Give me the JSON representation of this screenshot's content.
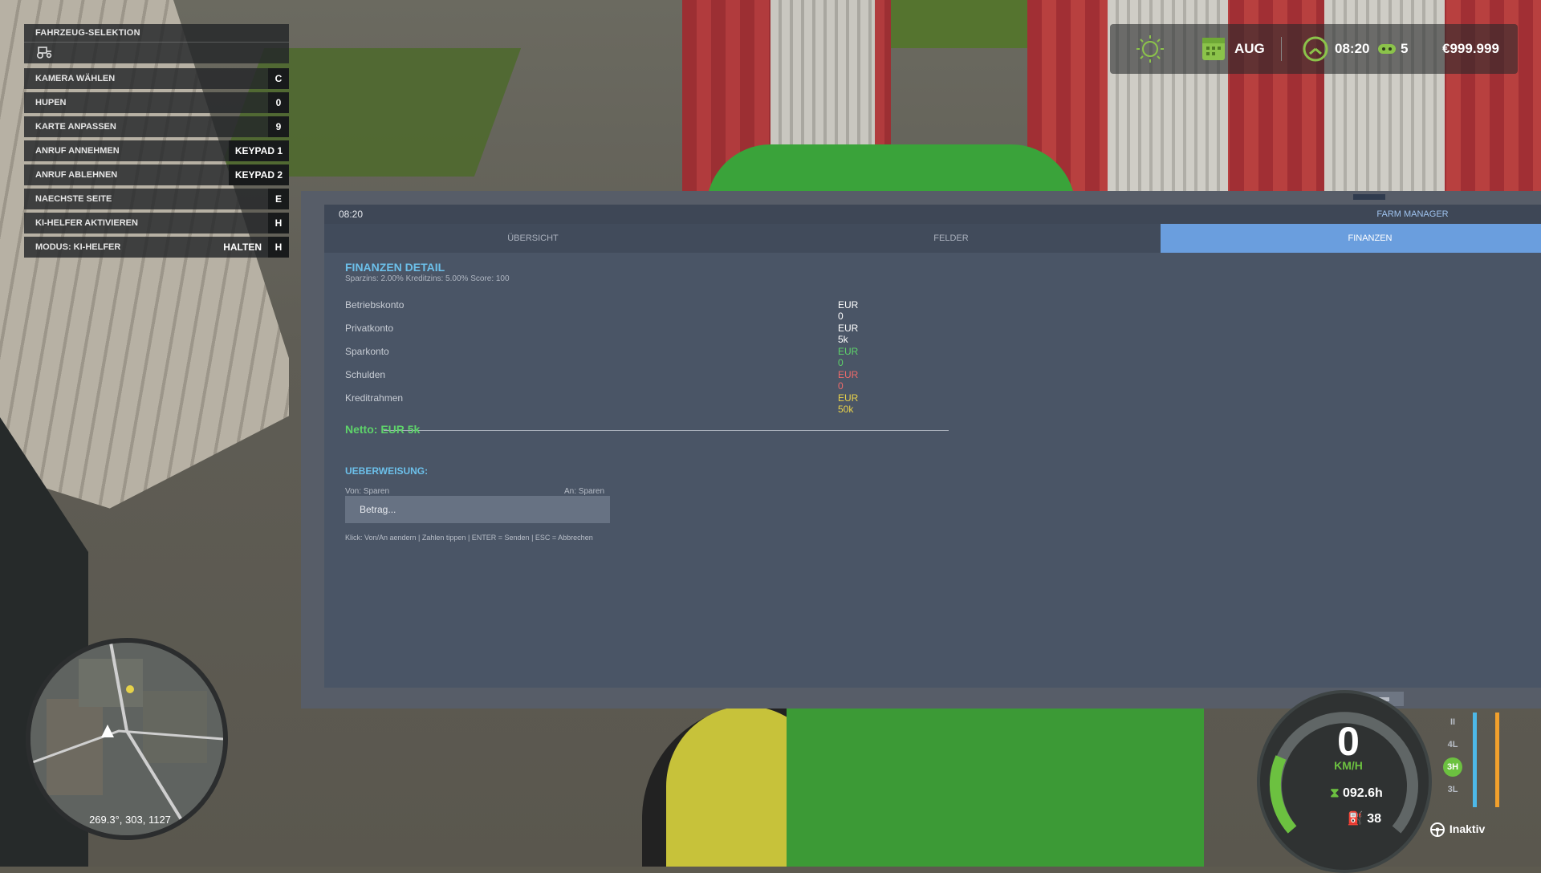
{
  "keybinds": {
    "header": "FAHRZEUG-SELEKTION",
    "items": [
      {
        "label": "KAMERA WÄHLEN",
        "key": "C"
      },
      {
        "label": "HUPEN",
        "key": "0"
      },
      {
        "label": "KARTE ANPASSEN",
        "key": "9"
      },
      {
        "label": "ANRUF ANNEHMEN",
        "key": "KEYPAD 1"
      },
      {
        "label": "ANRUF ABLEHNEN",
        "key": "KEYPAD 2"
      },
      {
        "label": "NAECHSTE SEITE",
        "key": "E"
      },
      {
        "label": "KI-HELFER AKTIVIEREN",
        "key": "H"
      }
    ],
    "mode": {
      "label": "MODUS: KI-HELFER",
      "hold": "HALTEN",
      "key": "H"
    }
  },
  "hud": {
    "month": "AUG",
    "time": "08:20",
    "helpers": "5",
    "money": "€999.999"
  },
  "panel": {
    "clock": "08:20",
    "app_title": "FARM MANAGER",
    "tabs": [
      {
        "label": "ÜBERSICHT",
        "active": false
      },
      {
        "label": "FELDER",
        "active": false
      },
      {
        "label": "FINANZEN",
        "active": true
      }
    ],
    "finance": {
      "title": "FINANZEN DETAIL",
      "subtitle": "Sparzins: 2.00%   Kreditzins: 5.00%   Score: 100",
      "rows": [
        {
          "label": "Betriebskonto",
          "value": "EUR 0",
          "color": "#ffffff"
        },
        {
          "label": "Privatkonto",
          "value": "EUR 5k",
          "color": "#ffffff"
        },
        {
          "label": "Sparkonto",
          "value": "EUR 0",
          "color": "#5ed36a"
        },
        {
          "label": "Schulden",
          "value": "EUR 0",
          "color": "#ef6a6a"
        },
        {
          "label": "Kreditrahmen",
          "value": "EUR 50k",
          "color": "#e9d24a"
        }
      ],
      "netto": "Netto: EUR 5k"
    },
    "transfer": {
      "title": "UEBERWEISUNG:",
      "from": "Von: Sparen",
      "to": "An: Sparen",
      "amount_placeholder": "Betrag...",
      "help": "Klick: Von/An aendern | Zahlen tippen | ENTER = Senden | ESC = Abbrechen"
    }
  },
  "minimap": {
    "coords": "269.3°, 303, 1127"
  },
  "dashboard": {
    "speed": "0",
    "unit": "KM/H",
    "hours": "092.6h",
    "fuel": "38",
    "gears": [
      "II",
      "4L",
      "3H",
      "3L"
    ],
    "active_gear": "3H",
    "cruise_status": "Inaktiv"
  }
}
